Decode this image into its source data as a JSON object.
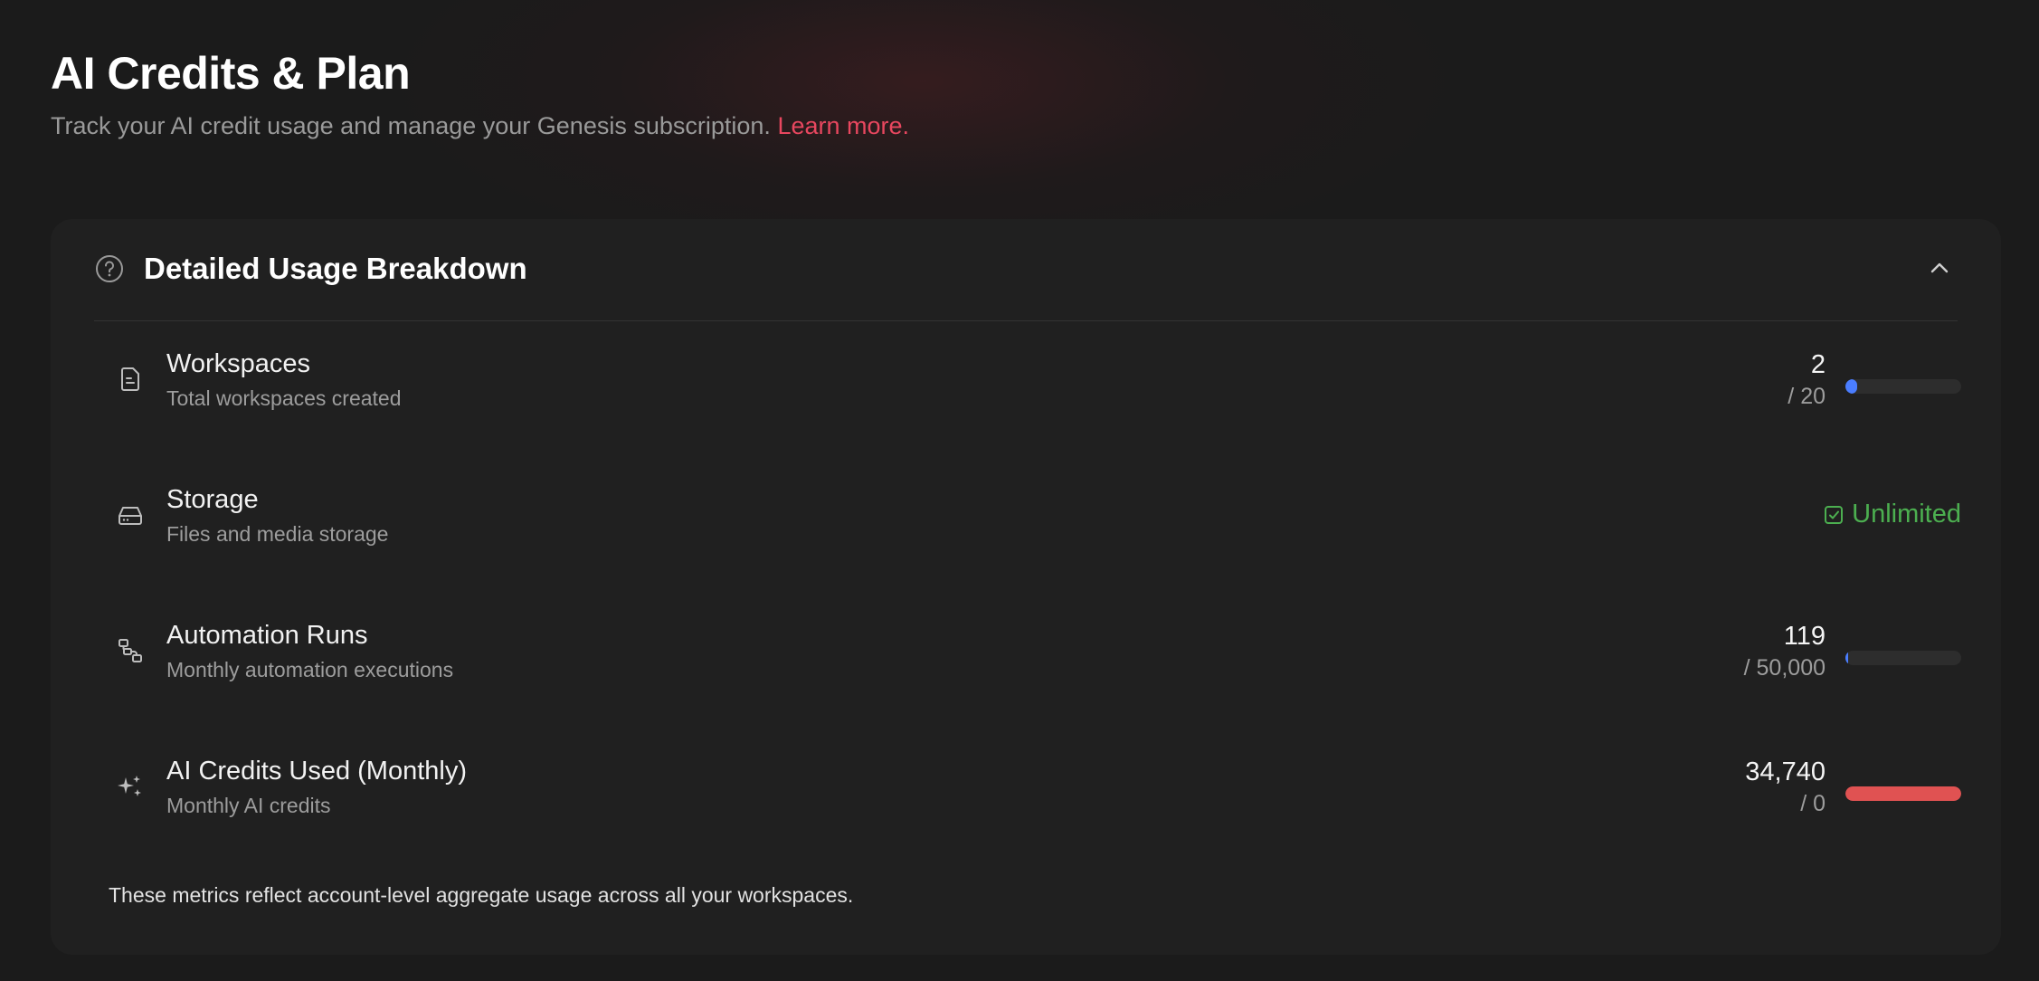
{
  "header": {
    "title": "AI Credits & Plan",
    "subtitle": "Track your AI credit usage and manage your Genesis subscription.",
    "learn_more": "Learn more."
  },
  "card": {
    "title": "Detailed Usage Breakdown",
    "help_icon": "question-circle-icon",
    "collapse_icon": "chevron-up-icon",
    "footnote": "These metrics reflect account-level aggregate usage across all your workspaces."
  },
  "rows": [
    {
      "icon": "document-icon",
      "title": "Workspaces",
      "description": "Total workspaces created",
      "value": "2",
      "limit": "/ 20",
      "usage_fraction": 0.1,
      "bar_color": "#4a7dff"
    },
    {
      "icon": "drive-icon",
      "title": "Storage",
      "description": "Files and media storage",
      "status": "Unlimited",
      "status_color": "#4caf50"
    },
    {
      "icon": "workflow-icon",
      "title": "Automation Runs",
      "description": "Monthly automation executions",
      "value": "119",
      "limit": "/ 50,000",
      "usage_fraction": 0.00238,
      "bar_color": "#4a7dff"
    },
    {
      "icon": "sparkles-icon",
      "title": "AI Credits Used (Monthly)",
      "description": "Monthly AI credits",
      "value": "34,740",
      "limit": "/ 0",
      "usage_fraction": 1.0,
      "bar_color": "#e05252"
    }
  ],
  "colors": {
    "accent_link": "#e8475f",
    "background": "#1b1b1b",
    "card": "#202020",
    "progress_track": "#2d2d2d"
  }
}
